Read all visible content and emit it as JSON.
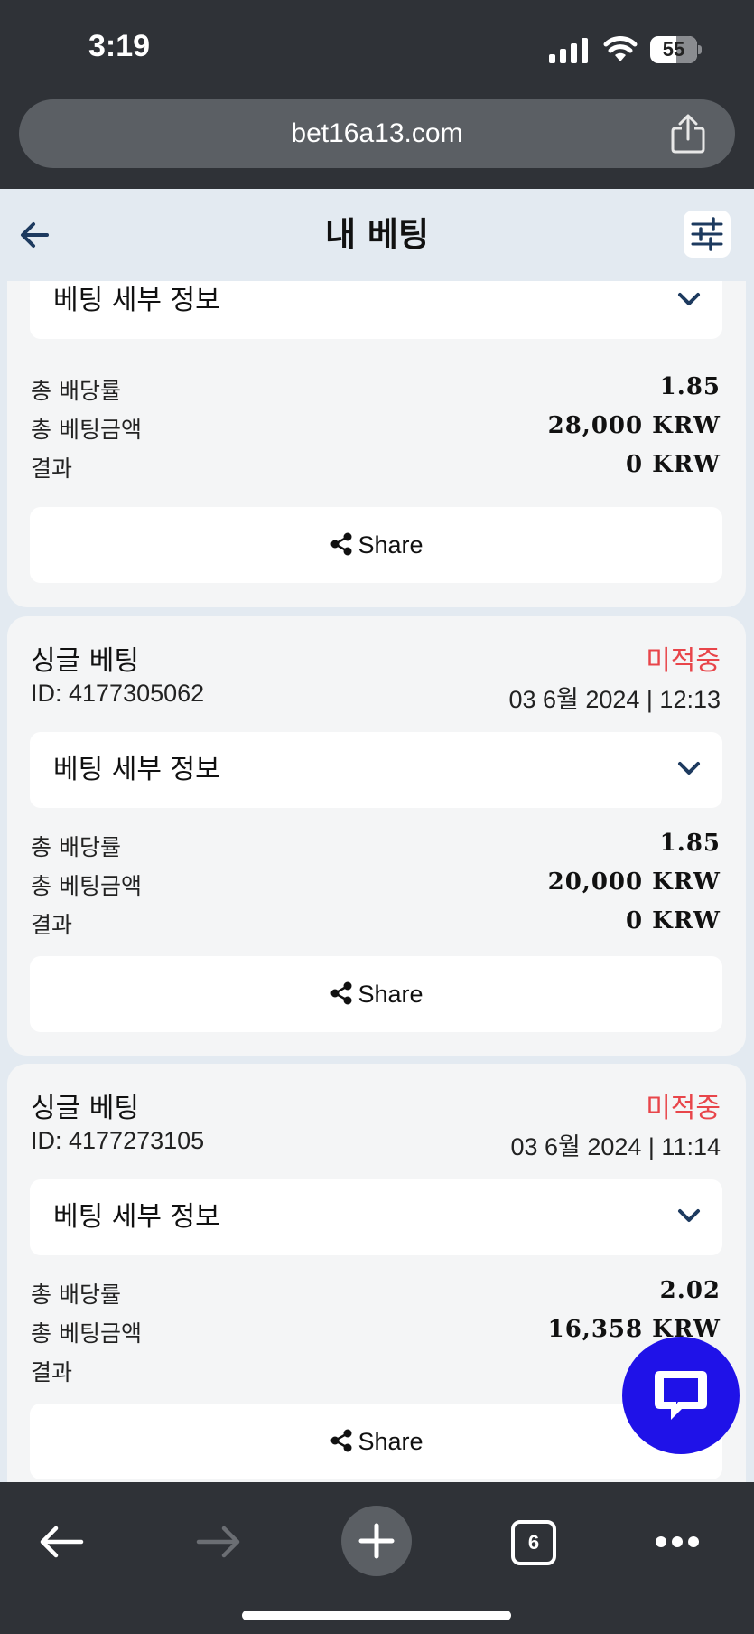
{
  "status_bar": {
    "time": "3:19",
    "battery": "55",
    "battery_level_percent": 55,
    "icons": [
      "signal-icon",
      "wifi-icon",
      "battery-icon"
    ]
  },
  "browser": {
    "url": "bet16a13.com",
    "tab_count": "6",
    "icons": [
      "share-icon",
      "back-icon",
      "forward-icon",
      "plus-icon",
      "more-icon"
    ]
  },
  "header": {
    "title": "내 베팅",
    "icons": [
      "back-arrow-icon",
      "filter-sliders-icon"
    ]
  },
  "cards": [
    {
      "details_label": "베팅 세부 정보",
      "rows": [
        {
          "label": "총 배당률",
          "value": "1.85"
        },
        {
          "label": "총 베팅금액",
          "value": "28,000 KRW"
        },
        {
          "label": "결과",
          "value": "0 KRW"
        }
      ],
      "share_label": "Share"
    },
    {
      "title": "싱글 베팅",
      "status": "미적중",
      "id": "ID: 4177305062",
      "date": "03 6월 2024 | 12:13",
      "details_label": "베팅 세부 정보",
      "rows": [
        {
          "label": "총 배당률",
          "value": "1.85"
        },
        {
          "label": "총 베팅금액",
          "value": "20,000 KRW"
        },
        {
          "label": "결과",
          "value": "0 KRW"
        }
      ],
      "share_label": "Share"
    },
    {
      "title": "싱글 베팅",
      "status": "미적중",
      "id": "ID: 4177273105",
      "date": "03 6월 2024 | 11:14",
      "details_label": "베팅 세부 정보",
      "rows": [
        {
          "label": "총 배당률",
          "value": "2.02"
        },
        {
          "label": "총 베팅금액",
          "value": "16,358 KRW"
        },
        {
          "label": "결과",
          "value": ""
        }
      ],
      "share_label": "Share"
    }
  ],
  "colors": {
    "status_lost": "#e8454a",
    "chat_fab": "#1f12e8",
    "header_bg": "#e3eaf1",
    "accent_navy": "#1d3a5f"
  }
}
